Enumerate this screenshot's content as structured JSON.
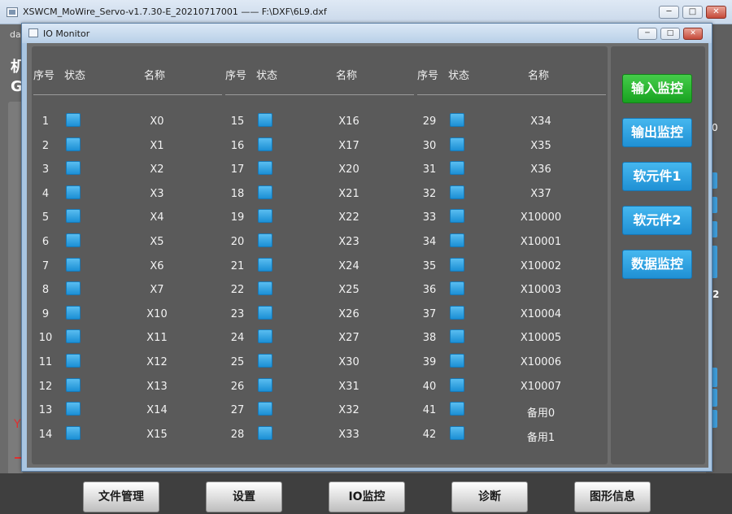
{
  "main": {
    "title": "XSWCM_MoWire_Servo-v1.7.30-E_20210717001 —— F:\\DXF\\6L9.dxf",
    "partial_labels": [
      "da",
      "机",
      "G",
      "Y",
      "0",
      "2"
    ]
  },
  "io_dialog": {
    "title": "IO Monitor",
    "headers": {
      "index": "序号",
      "status": "状态",
      "name": "名称"
    },
    "columns": [
      [
        {
          "n": "1",
          "name": "X0"
        },
        {
          "n": "2",
          "name": "X1"
        },
        {
          "n": "3",
          "name": "X2"
        },
        {
          "n": "4",
          "name": "X3"
        },
        {
          "n": "5",
          "name": "X4"
        },
        {
          "n": "6",
          "name": "X5"
        },
        {
          "n": "7",
          "name": "X6"
        },
        {
          "n": "8",
          "name": "X7"
        },
        {
          "n": "9",
          "name": "X10"
        },
        {
          "n": "10",
          "name": "X11"
        },
        {
          "n": "11",
          "name": "X12"
        },
        {
          "n": "12",
          "name": "X13"
        },
        {
          "n": "13",
          "name": "X14"
        },
        {
          "n": "14",
          "name": "X15"
        }
      ],
      [
        {
          "n": "15",
          "name": "X16"
        },
        {
          "n": "16",
          "name": "X17"
        },
        {
          "n": "17",
          "name": "X20"
        },
        {
          "n": "18",
          "name": "X21"
        },
        {
          "n": "19",
          "name": "X22"
        },
        {
          "n": "20",
          "name": "X23"
        },
        {
          "n": "21",
          "name": "X24"
        },
        {
          "n": "22",
          "name": "X25"
        },
        {
          "n": "23",
          "name": "X26"
        },
        {
          "n": "24",
          "name": "X27"
        },
        {
          "n": "25",
          "name": "X30"
        },
        {
          "n": "26",
          "name": "X31"
        },
        {
          "n": "27",
          "name": "X32"
        },
        {
          "n": "28",
          "name": "X33"
        }
      ],
      [
        {
          "n": "29",
          "name": "X34"
        },
        {
          "n": "30",
          "name": "X35"
        },
        {
          "n": "31",
          "name": "X36"
        },
        {
          "n": "32",
          "name": "X37"
        },
        {
          "n": "33",
          "name": "X10000"
        },
        {
          "n": "34",
          "name": "X10001"
        },
        {
          "n": "35",
          "name": "X10002"
        },
        {
          "n": "36",
          "name": "X10003"
        },
        {
          "n": "37",
          "name": "X10004"
        },
        {
          "n": "38",
          "name": "X10005"
        },
        {
          "n": "39",
          "name": "X10006"
        },
        {
          "n": "40",
          "name": "X10007"
        },
        {
          "n": "41",
          "name": "备用0"
        },
        {
          "n": "42",
          "name": "备用1"
        }
      ]
    ],
    "side_buttons": [
      {
        "label": "输入监控",
        "active": true
      },
      {
        "label": "输出监控",
        "active": false
      },
      {
        "label": "软元件1",
        "active": false
      },
      {
        "label": "软元件2",
        "active": false
      },
      {
        "label": "数据监控",
        "active": false
      }
    ],
    "colors": {
      "indicator": "#2a9ee0",
      "active_button": "#2ab52f",
      "button": "#2e9fe0"
    }
  },
  "bottom_bar": {
    "buttons": [
      "文件管理",
      "设置",
      "IO监控",
      "诊断",
      "图形信息"
    ]
  }
}
